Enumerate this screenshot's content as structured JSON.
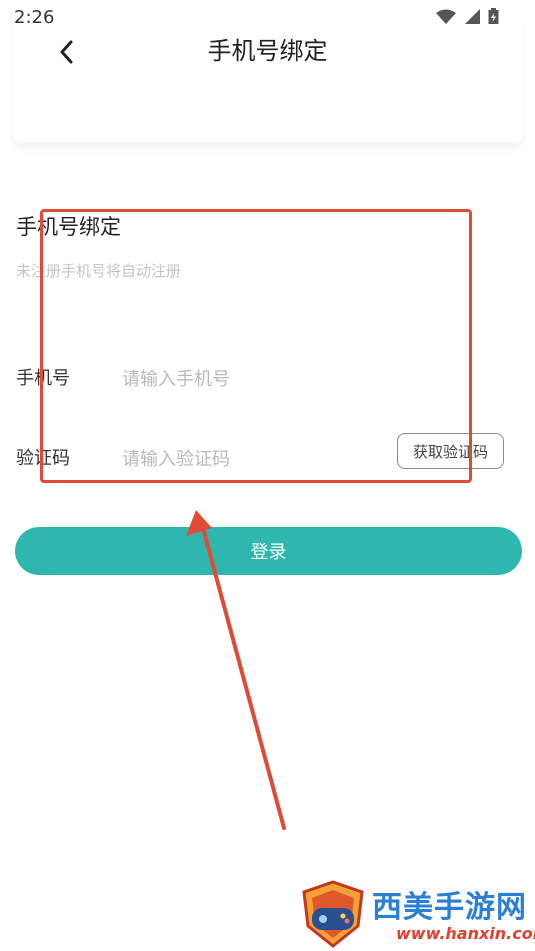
{
  "status_bar": {
    "time": "2:26"
  },
  "header": {
    "back_icon": "chevron-left-icon",
    "title": "手机号绑定"
  },
  "form": {
    "title": "手机号绑定",
    "subtitle": "未注册手机号将自动注册",
    "phone": {
      "label": "手机号",
      "placeholder": "请输入手机号",
      "value": ""
    },
    "code": {
      "label": "验证码",
      "placeholder": "请输入验证码",
      "value": "",
      "get_code_label": "获取验证码"
    },
    "login_label": "登录"
  },
  "colors": {
    "accent": "#2eb7ae",
    "annotation": "#e04b35",
    "placeholder": "#b9b9b9"
  },
  "watermark": {
    "name": "西美手游网",
    "url": "www.hanxin.com"
  }
}
